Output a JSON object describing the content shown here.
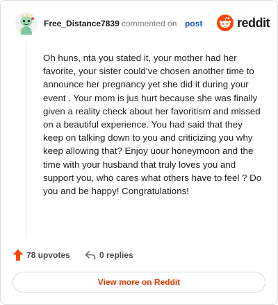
{
  "header": {
    "username": "Free_Distance7839",
    "commented_text": "commented on",
    "post_link": "post",
    "brand": "reddit"
  },
  "comment": {
    "body": "Oh huns, nta you stated it, your mother had her favorite, your sister could’ve chosen another time to announce her pregnancy yet she did it during your event . Your mom is jus hurt because she was finally given a reality check about her favoritism and missed on a beautiful experience. You had said that they keep on talking down to you and criticizing you why keep allowing that? Enjoy uour honeymoon and the time with your husband that truly loves you and support you, who cares what others have to feel ? Do you and be happy! Congratulations!"
  },
  "actions": {
    "upvotes": "78 upvotes",
    "replies": "0 replies"
  },
  "footer": {
    "view_more": "View more on Reddit"
  },
  "colors": {
    "accent": "#d93a00",
    "link": "#1a56c4",
    "upvote": "#ff4500",
    "brand": "#ff4500"
  },
  "icons": {
    "avatar": "snoo-avatar-icon",
    "brand": "reddit-logo-icon",
    "upvote": "upvote-arrow-icon",
    "reply": "reply-arrow-icon"
  }
}
